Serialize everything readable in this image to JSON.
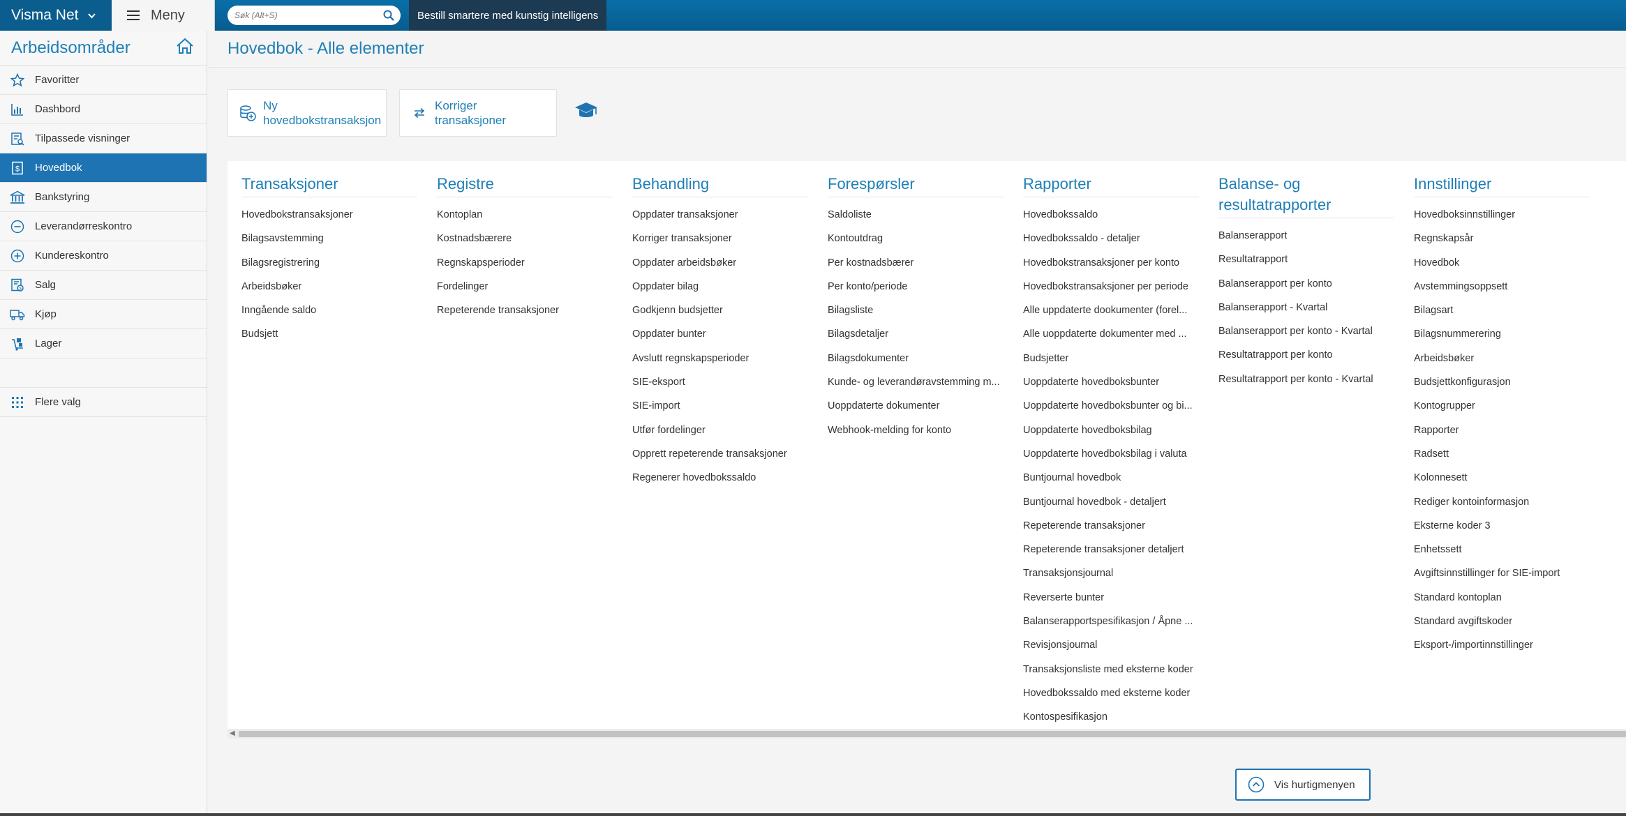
{
  "topbar": {
    "brand": "Visma Net",
    "menu_label": "Meny",
    "search_placeholder": "Søk (Alt+S)",
    "ai_banner": "Bestill smartere med kunstig intelligens"
  },
  "sidebar": {
    "title": "Arbeidsområder",
    "items": [
      {
        "label": "Favoritter",
        "icon": "star-icon"
      },
      {
        "label": "Dashbord",
        "icon": "bar-chart-icon"
      },
      {
        "label": "Tilpassede visninger",
        "icon": "custom-view-icon"
      },
      {
        "label": "Hovedbok",
        "icon": "ledger-icon",
        "active": true
      },
      {
        "label": "Bankstyring",
        "icon": "bank-icon"
      },
      {
        "label": "Leverandørreskontro",
        "icon": "minus-circle-icon"
      },
      {
        "label": "Kundereskontro",
        "icon": "plus-circle-icon"
      },
      {
        "label": "Salg",
        "icon": "sales-icon"
      },
      {
        "label": "Kjøp",
        "icon": "truck-icon"
      },
      {
        "label": "Lager",
        "icon": "inventory-icon"
      }
    ],
    "more": {
      "label": "Flere valg",
      "icon": "grid-icon"
    }
  },
  "main": {
    "title": "Hovedbok - Alle elementer",
    "quick_buttons": [
      {
        "label_line1": "Ny",
        "label_line2": "hovedbokstransaksjon",
        "icon": "new-transaction-icon"
      },
      {
        "label_line1": "Korriger",
        "label_line2": "transaksjoner",
        "icon": "swap-arrows-icon"
      }
    ],
    "columns": [
      {
        "title": "Transaksjoner",
        "links": [
          "Hovedbokstransaksjoner",
          "Bilagsavstemming",
          "Bilagsregistrering",
          "Arbeidsbøker",
          "Inngående saldo",
          "Budsjett"
        ]
      },
      {
        "title": "Registre",
        "links": [
          "Kontoplan",
          "Kostnadsbærere",
          "Regnskapsperioder",
          "Fordelinger",
          "Repeterende transaksjoner"
        ]
      },
      {
        "title": "Behandling",
        "links": [
          "Oppdater transaksjoner",
          "Korriger transaksjoner",
          "Oppdater arbeidsbøker",
          "Oppdater bilag",
          "Godkjenn budsjetter",
          "Oppdater bunter",
          "Avslutt regnskapsperioder",
          "SIE-eksport",
          "SIE-import",
          "Utfør fordelinger",
          "Opprett repeterende transaksjoner",
          "Regenerer hovedbokssaldo"
        ]
      },
      {
        "title": "Forespørsler",
        "links": [
          "Saldoliste",
          "Kontoutdrag",
          "Per kostnadsbærer",
          "Per konto/periode",
          "Bilagsliste",
          "Bilagsdetaljer",
          "Bilagsdokumenter",
          "Kunde- og leverandøravstemming m...",
          "Uoppdaterte dokumenter",
          "Webhook-melding for konto"
        ]
      },
      {
        "title": "Rapporter",
        "links": [
          "Hovedbokssaldo",
          "Hovedbokssaldo - detaljer",
          "Hovedbokstransaksjoner per konto",
          "Hovedbokstransaksjoner per periode",
          "Alle uppdaterte dookumenter (forel...",
          "Alle uoppdaterte dokumenter med ...",
          "Budsjetter",
          "Uoppdaterte hovedboksbunter",
          "Uoppdaterte hovedboksbunter og bi...",
          "Uoppdaterte hovedboksbilag",
          "Uoppdaterte hovedboksbilag i valuta",
          "Buntjournal hovedbok",
          "Buntjournal hovedbok - detaljert",
          "Repeterende transaksjoner",
          "Repeterende transaksjoner detaljert",
          "Transaksjonsjournal",
          "Reverserte bunter",
          "Balanserapportspesifikasjon / Åpne ...",
          "Revisjonsjournal",
          "Transaksjonsliste med eksterne koder",
          "Hovedbokssaldo med eksterne koder",
          "Kontospesifikasjon"
        ]
      },
      {
        "title": "Balanse- og resultatrapporter",
        "links": [
          "Balanserapport",
          "Resultatrapport",
          "Balanserapport per konto",
          "Balanserapport - Kvartal",
          "Balanserapport per konto - Kvartal",
          "Resultatrapport per konto",
          "Resultatrapport per konto - Kvartal"
        ]
      },
      {
        "title": "Innstillinger",
        "links": [
          "Hovedboksinnstillinger",
          "Regnskapsår",
          "Hovedbok",
          "Avstemmingsoppsett",
          "Bilagsart",
          "Bilagsnummerering",
          "Arbeidsbøker",
          "Budsjettkonfigurasjon",
          "Kontogrupper",
          "Rapporter",
          "Radsett",
          "Kolonnesett",
          "Rediger kontoinformasjon",
          "Eksterne koder 3",
          "Enhetssett",
          "Avgiftsinnstillinger for SIE-import",
          "Standard kontoplan",
          "Standard avgiftskoder",
          "Eksport-/importinnstillinger"
        ]
      }
    ],
    "quickmenu_label": "Vis hurtigmenyen"
  },
  "colors": {
    "accent": "#1f7fb6",
    "topbar": "#0a6fa8",
    "active": "#1e74b2"
  }
}
